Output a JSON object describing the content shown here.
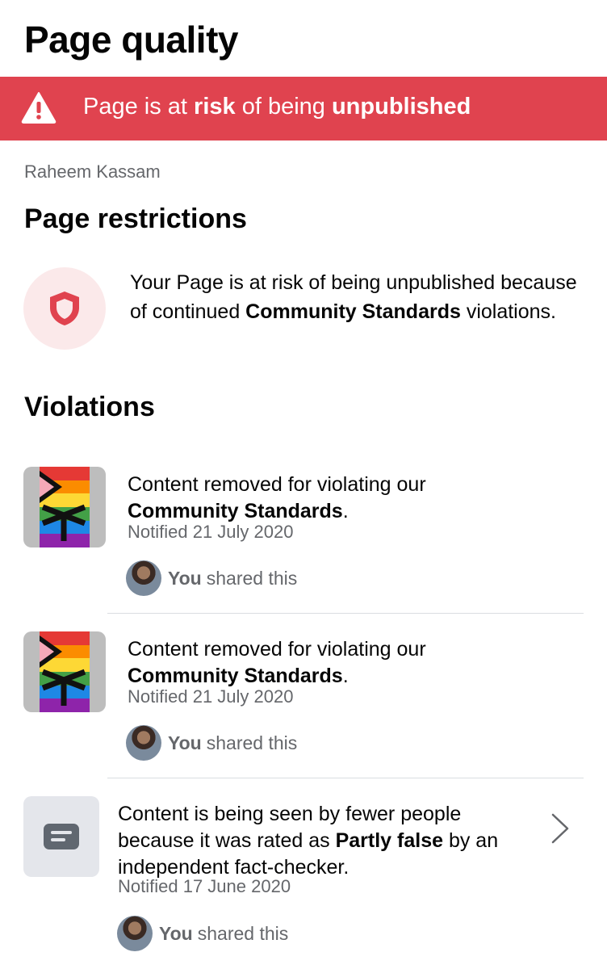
{
  "header": {
    "title": "Page quality"
  },
  "banner": {
    "prefix": "Page is at ",
    "risk": "risk",
    "middle": " of being ",
    "unpublished": "unpublished",
    "icon": "warning-triangle-icon",
    "color": "#e0434f"
  },
  "page_name": "Raheem Kassam",
  "restrictions": {
    "heading": "Page restrictions",
    "icon": "shield-icon",
    "text_1": "Your Page is at risk of being unpublished because of continued ",
    "bold": "Community Standards",
    "text_2": " violations."
  },
  "violations": {
    "heading": "Violations",
    "items": [
      {
        "text_1": "Content removed for violating our ",
        "bold": "Community Standards",
        "text_2": ".",
        "notified": "Notified 21 July 2020",
        "shared_you": "You",
        "shared_rest": "shared this"
      },
      {
        "text_1": "Content removed for violating our ",
        "bold": "Community Standards",
        "text_2": ".",
        "notified": "Notified 21 July 2020",
        "shared_you": "You",
        "shared_rest": "shared this"
      },
      {
        "text_1": "Content is being seen by fewer people because it was rated as ",
        "bold": "Partly false",
        "text_2": " by an independent fact-checker.",
        "notified": "Notified 17 June 2020",
        "shared_you": "You",
        "shared_rest": "shared this",
        "icon": "post-text-icon"
      }
    ]
  }
}
